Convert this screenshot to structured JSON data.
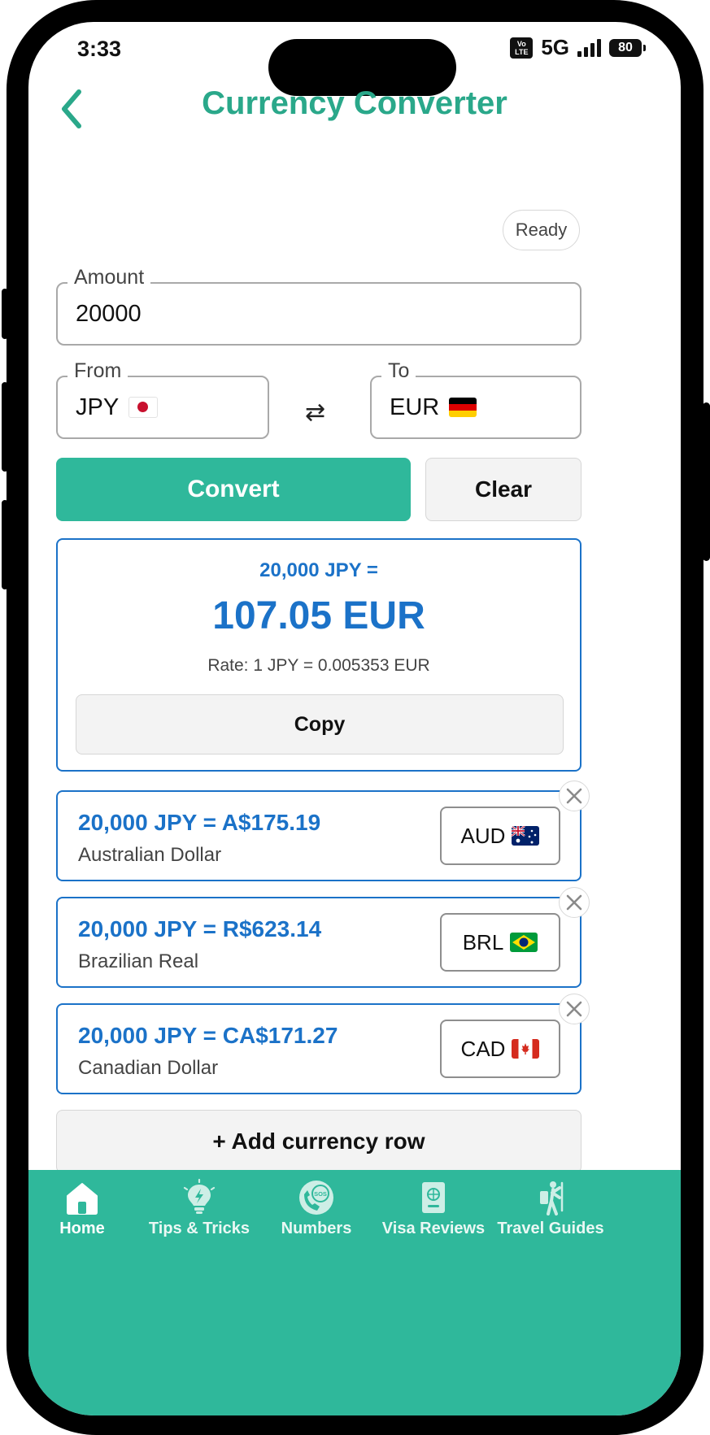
{
  "status_bar": {
    "time": "3:33",
    "volte": "Vo LTE",
    "network": "5G",
    "battery": "80"
  },
  "header": {
    "title": "Currency Converter",
    "back_icon": "chevron-left-icon"
  },
  "status_badge": "Ready",
  "amount": {
    "label": "Amount",
    "value": "20000"
  },
  "from": {
    "label": "From",
    "code": "JPY",
    "flag": "japan-flag"
  },
  "to": {
    "label": "To",
    "code": "EUR",
    "flag": "germany-flag"
  },
  "swap_glyph": "⇄",
  "actions": {
    "convert_label": "Convert",
    "clear_label": "Clear"
  },
  "result": {
    "source": "20,000 JPY =",
    "amount": "107.05 EUR",
    "rate": "Rate: 1 JPY = 0.005353 EUR",
    "copy_label": "Copy"
  },
  "rows": [
    {
      "amount": "20,000 JPY = A$175.19",
      "name": "Australian Dollar",
      "code": "AUD",
      "flag": "australia-flag"
    },
    {
      "amount": "20,000 JPY = R$623.14",
      "name": "Brazilian Real",
      "code": "BRL",
      "flag": "brazil-flag"
    },
    {
      "amount": "20,000 JPY = CA$171.27",
      "name": "Canadian Dollar",
      "code": "CAD",
      "flag": "canada-flag"
    }
  ],
  "add_row_label": "+ Add currency row",
  "nav": [
    {
      "label": "Home",
      "icon": "home-icon",
      "active": true
    },
    {
      "label": "Tips & Tricks",
      "icon": "lightbulb-icon",
      "active": false
    },
    {
      "label": "Numbers",
      "icon": "sos-phone-icon",
      "active": false
    },
    {
      "label": "Visa Reviews",
      "icon": "passport-icon",
      "active": false
    },
    {
      "label": "Travel Guides",
      "icon": "traveler-icon",
      "active": false
    }
  ],
  "colors": {
    "brand": "#2fb89b",
    "title": "#2aa88a",
    "accent_blue": "#1b72c8"
  }
}
